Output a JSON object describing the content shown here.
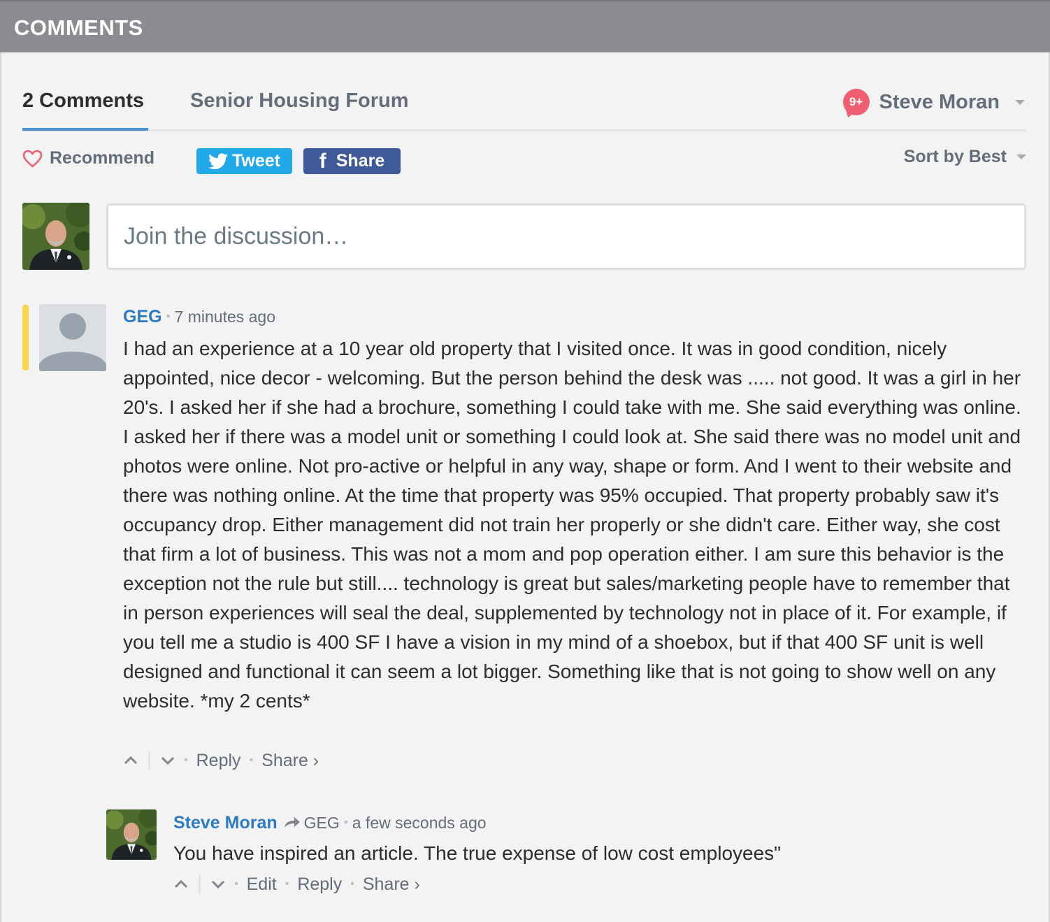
{
  "header": {
    "title": "COMMENTS"
  },
  "nav": {
    "comments_tab": "2 Comments",
    "forum_tab": "Senior Housing Forum",
    "notification_badge": "9+",
    "user_name": "Steve Moran"
  },
  "actions": {
    "recommend": "Recommend",
    "tweet": "Tweet",
    "share": "Share",
    "sort": "Sort by Best"
  },
  "composer": {
    "placeholder": "Join the discussion…"
  },
  "comments": [
    {
      "author": "GEG",
      "time": "7 minutes ago",
      "body": "I had an experience at a 10 year old property that I visited once. It was in good condition, nicely appointed, nice decor - welcoming. But the person behind the desk was ..... not good. It was a girl in her 20's. I asked her if she had a brochure, something I could take with me. She said everything was online. I asked her if there was a model unit or something I could look at. She said there was no model unit and photos were online. Not pro-active or helpful in any way, shape or form. And I went to their website and there was nothing online. At the time that property was 95% occupied. That property probably saw it's occupancy drop. Either management did not train her properly or she didn't care. Either way, she cost that firm a lot of business. This was not a mom and pop operation either. I am sure this behavior is the exception not the rule but still.... technology is great but sales/marketing people have to remember that in person experiences will seal the deal, supplemented by technology not in place of it. For example, if you tell me a studio is 400 SF I have a vision in my mind of a shoebox, but if that 400 SF unit is well designed and functional it can seem a lot bigger. Something like that is not going to show well on any website. *my 2 cents*",
      "reply_label": "Reply",
      "share_label": "Share ›"
    },
    {
      "author": "Steve Moran",
      "in_reply_to": "GEG",
      "time": "a few seconds ago",
      "body": "You have inspired an article. The true expense of low cost employees\"",
      "edit_label": "Edit",
      "reply_label": "Reply",
      "share_label": "Share ›"
    }
  ],
  "colors": {
    "header_bg": "#8a8c90",
    "link_blue": "#2e7bc4",
    "twitter": "#20a8e8",
    "facebook": "#3f5a98",
    "badge": "#f05f70",
    "new_marker": "#f9d649"
  }
}
